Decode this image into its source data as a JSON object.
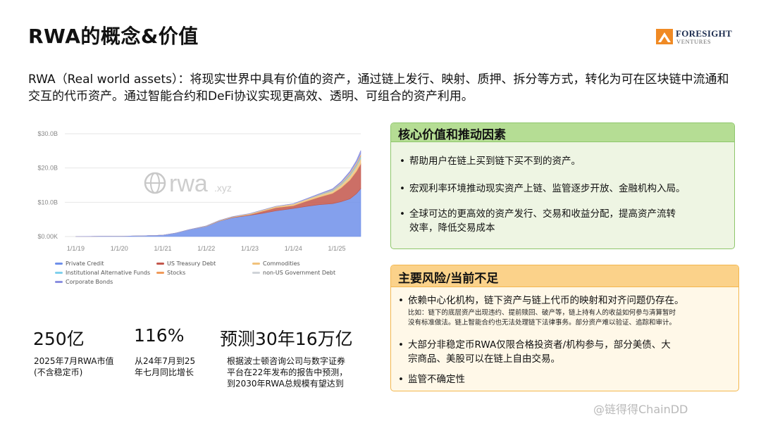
{
  "title": "RWA的概念&价值",
  "logo": {
    "name": "FORESIGHT",
    "sub": "VENTURES"
  },
  "intro": "RWA（Real world assets）：将现实世界中具有价值的资产，通过链上发行、映射、质押、拆分等方式，转化为可在区块链中流通和交互的代币资产。通过智能合约和DeFi协议实现更高效、透明、可组合的资产利用。",
  "chart_data": {
    "type": "area",
    "watermark": "rwa",
    "watermark_suffix": ".xyz",
    "y_ticks": [
      "$30.0B",
      "$20.0B",
      "$10.0B",
      "$0.00K"
    ],
    "ylim": [
      0,
      30
    ],
    "x_ticks": [
      "1/1/19",
      "1/1/20",
      "1/1/21",
      "1/1/22",
      "1/1/23",
      "1/1/24",
      "1/1/25"
    ],
    "x": [
      2019.0,
      2020.0,
      2020.5,
      2021.0,
      2021.3,
      2021.6,
      2022.0,
      2022.3,
      2022.6,
      2023.0,
      2023.3,
      2023.6,
      2024.0,
      2024.3,
      2024.6,
      2024.9,
      2025.1,
      2025.3,
      2025.45,
      2025.55
    ],
    "series": [
      {
        "name": "Private Credit",
        "color": "#6e8fea",
        "values": [
          0,
          0.1,
          0.2,
          0.4,
          1.0,
          2.0,
          3.0,
          4.5,
          5.5,
          6.2,
          6.8,
          7.5,
          8.2,
          8.8,
          9.3,
          9.6,
          10.2,
          11.0,
          12.5,
          14.0
        ]
      },
      {
        "name": "US Treasury Debt",
        "color": "#c3564b",
        "values": [
          0,
          0,
          0,
          0,
          0,
          0,
          0,
          0.05,
          0.1,
          0.2,
          0.6,
          0.9,
          0.8,
          1.5,
          2.2,
          3.0,
          4.0,
          5.5,
          6.5,
          7.2
        ]
      },
      {
        "name": "Commodities",
        "color": "#f1c27b",
        "values": [
          0,
          0,
          0,
          0,
          0,
          0,
          0.1,
          0.15,
          0.2,
          0.3,
          0.35,
          0.4,
          0.5,
          0.55,
          0.6,
          0.7,
          0.9,
          1.2,
          1.4,
          1.6
        ]
      },
      {
        "name": "Institutional Alternative Funds",
        "color": "#7fd0ec",
        "values": [
          0,
          0,
          0,
          0,
          0,
          0,
          0,
          0,
          0,
          0,
          0,
          0,
          0,
          0,
          0.1,
          0.2,
          0.3,
          0.4,
          0.5,
          0.6
        ]
      },
      {
        "name": "Stocks",
        "color": "#f09a5a",
        "values": [
          0,
          0,
          0,
          0,
          0,
          0,
          0,
          0,
          0,
          0,
          0,
          0,
          0,
          0,
          0.05,
          0.08,
          0.15,
          0.3,
          0.4,
          0.5
        ]
      },
      {
        "name": "non-US Government Debt",
        "color": "#cfd3d8",
        "values": [
          0,
          0,
          0,
          0,
          0,
          0,
          0,
          0,
          0,
          0,
          0.02,
          0.03,
          0.05,
          0.08,
          0.1,
          0.15,
          0.2,
          0.25,
          0.3,
          0.3
        ]
      },
      {
        "name": "Corporate Bonds",
        "color": "#8a8fe0",
        "values": [
          0,
          0,
          0,
          0,
          0,
          0,
          0,
          0,
          0,
          0,
          0,
          0,
          0.05,
          0.1,
          0.15,
          0.2,
          0.3,
          0.4,
          0.6,
          0.9
        ]
      }
    ],
    "legend": "bottom",
    "grid": true
  },
  "stats": [
    {
      "value": "250亿",
      "line1": "2025年7月RWA市值",
      "line2": "(不含稳定币)"
    },
    {
      "value": "116%",
      "line1": "从24年7月到25",
      "line2": "年七月同比增长"
    },
    {
      "value": "预测30年16万亿",
      "line1": "根据波士顿咨询公司与数字证券",
      "line2": "平台在22年发布的报告中预测，",
      "line3": "到2030年RWA总规模有望达到"
    }
  ],
  "core_value": {
    "title": "核心价值和推动因素",
    "bullet": "•",
    "items": [
      {
        "line1": "帮助用户在链上买到链下买不到的资产。"
      },
      {
        "line1": "宏观利率环境推动现实资产上链、监管逐步开放、金融机构入局。"
      },
      {
        "line1": "全球可达的更高效的资产发行、交易和收益分配，提高资产流转",
        "line2": "效率，降低交易成本"
      }
    ]
  },
  "risks": {
    "title": "主要风险/当前不足",
    "bullet": "•",
    "item1": "依赖中心化机构，链下资产与链上代币的映射和对齐问题仍存在。",
    "item1_note_line1": "比如：链下的底层资产出现违约、提前赎回、破产等，链上持有人的收益如何参与清算暂时",
    "item1_note_line2": "没有标准做法。链上智能合约也无法处理链下法律事务。部分资产难以验证、追踪和审计。",
    "item2_line1": "大部分非稳定币RWA仅限合格投资者/机构参与，部分美债、大",
    "item2_line2": "宗商品、美股可以在链上自由交易。",
    "item3": "监管不确定性"
  },
  "watermark": "@链得得ChainDD"
}
